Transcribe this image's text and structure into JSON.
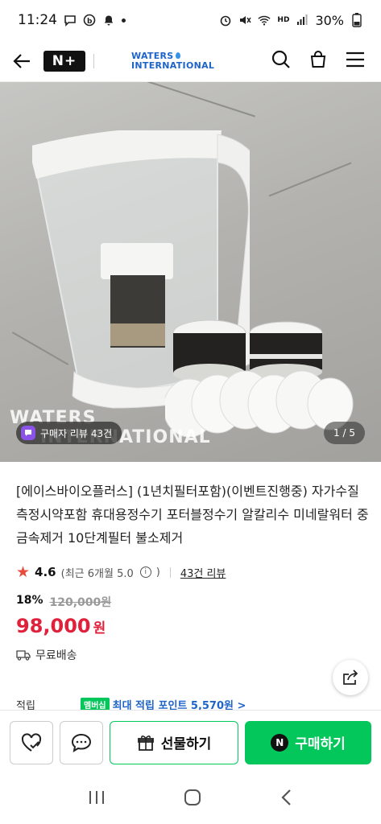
{
  "status_bar": {
    "time": "11:24",
    "battery": "30%",
    "signal_label": "HD"
  },
  "header": {
    "badge_text": "N+",
    "brand_line1": "WATERS",
    "brand_line2": "INTERNATIONAL"
  },
  "hero": {
    "watermark_line1": "WATERS",
    "watermark_line2": "INTERNATIONAL",
    "review_chip": "구매자 리뷰 43건",
    "pager": "1 / 5"
  },
  "product": {
    "title": "[에이스바이오플러스] (1년치필터포함)(이벤트진행중) 자가수질측정시약포함 휴대용정수기 포터블정수기 알칼리수 미네랄워터 중금속제거 10단계필터 불소제거",
    "rating": "4.6",
    "rating_sub": "(최근 6개월 5.0",
    "rating_sub_close": ")",
    "review_link": "43건 리뷰",
    "discount": "18%",
    "original_price": "120,000원",
    "price": "98,000",
    "price_unit": "원",
    "shipping": "무료배송",
    "points_label": "적립",
    "points_badge": "멤버십",
    "points_text": "최대 적립 포인트 5,570원 >"
  },
  "actions": {
    "gift_label": "선물하기",
    "buy_label": "구매하기",
    "buy_badge": "N"
  },
  "colors": {
    "accent_green": "#03c75a",
    "price_red": "#e0213c",
    "brand_blue": "#1f64c8"
  }
}
